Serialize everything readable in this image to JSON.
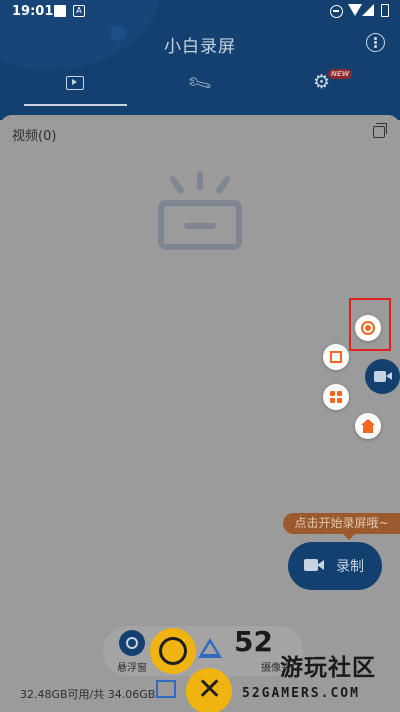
{
  "status_bar": {
    "time": "19:01"
  },
  "app": {
    "title": "小白录屏"
  },
  "tabs": [
    {
      "name": "video",
      "icon": "film-icon"
    },
    {
      "name": "tools",
      "icon": "wrench-icon"
    },
    {
      "name": "settings",
      "icon": "gear-icon",
      "badge": "NEW"
    }
  ],
  "content": {
    "video_count_label": "视频(0)"
  },
  "floating_menu": {
    "items": [
      "record-icon",
      "crop-icon",
      "grid-icon",
      "home-icon",
      "camera-icon"
    ]
  },
  "tooltip": {
    "text": "点击开始录屏哦~"
  },
  "record_button": {
    "label": "录制"
  },
  "dock": {
    "items": [
      {
        "label": "悬浮窗",
        "icon": "float-window-icon"
      },
      {
        "label": "",
        "icon": "brush-icon"
      },
      {
        "label": "摄像头",
        "icon": "camera-icon"
      }
    ]
  },
  "storage": {
    "text": "32.48GB可用/共 34.06GB"
  },
  "watermark": {
    "number": "52",
    "name_cn": "游玩社区",
    "name_en": "52GAMERS.COM"
  },
  "colors": {
    "brand": "#13406f",
    "accent": "#f26722",
    "highlight": "#e12020"
  }
}
